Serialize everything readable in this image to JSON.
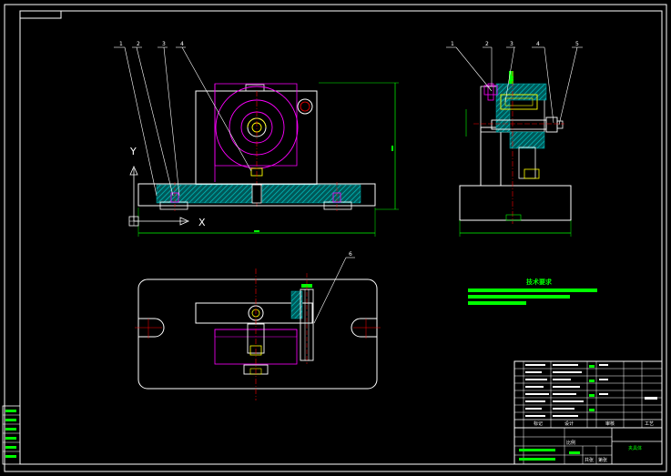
{
  "drawing": {
    "axis_labels": {
      "x": "X",
      "y": "Y"
    },
    "front_balloons": [
      "1",
      "2",
      "3",
      "4"
    ],
    "side_balloons": [
      "1",
      "2",
      "3",
      "4",
      "5"
    ],
    "top_balloon": "6",
    "tech_notes_title": "技术要求",
    "title_block": {
      "row_labels": [
        "标记",
        "设计",
        "审核",
        "工艺"
      ],
      "bottom_labels": [
        "比例",
        "共张",
        "第张"
      ],
      "name_cell": "夹具体"
    }
  },
  "colors": {
    "background": "#000000",
    "lines": "#ffffff",
    "hatch": "#00b3b3",
    "cyan_fill": "#00b3b3",
    "magenta": "#ff00ff",
    "dimension": "#00ff00",
    "center_line": "#ff0000",
    "yellow": "#ffff00"
  }
}
